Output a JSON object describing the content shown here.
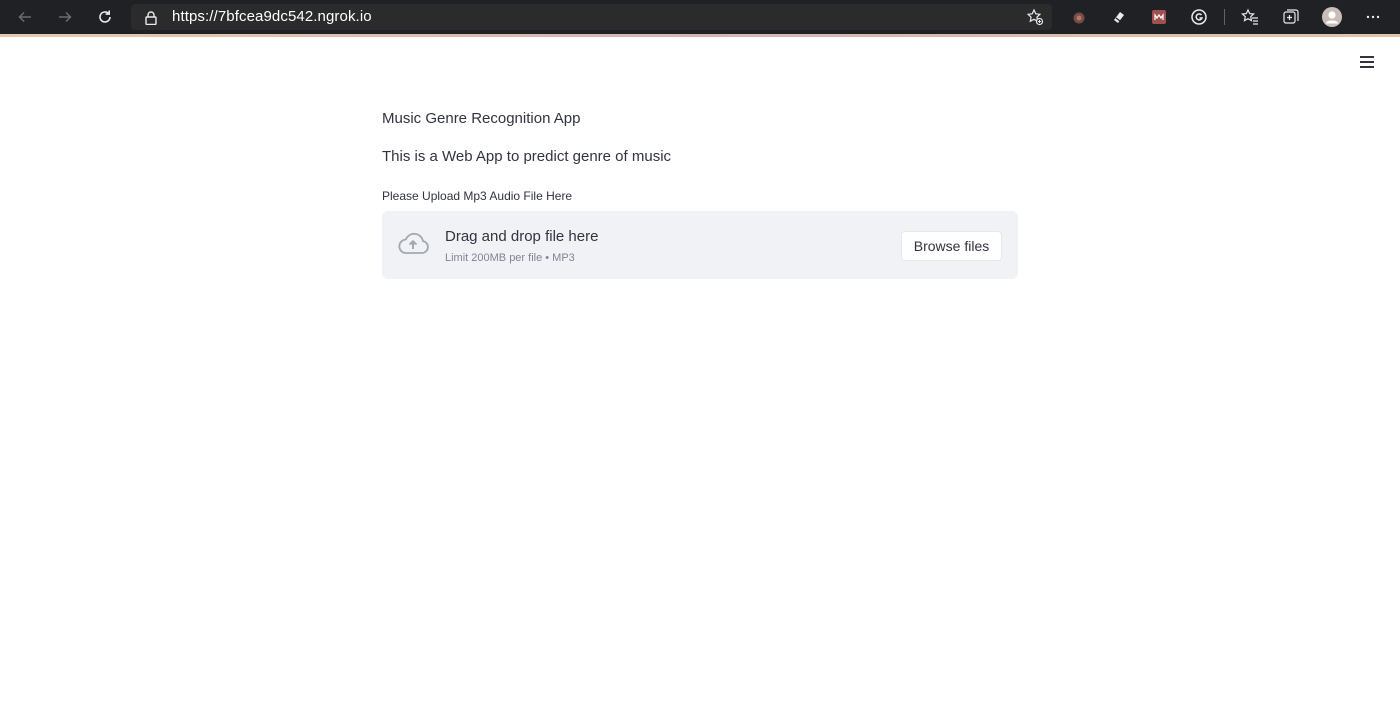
{
  "browser": {
    "url": "https://7bfcea9dc542.ngrok.io",
    "toolbar_icons": [
      "back-icon",
      "forward-icon",
      "refresh-icon",
      "lock-icon",
      "add-favorite-icon",
      "extension-icon",
      "extension-icon",
      "extension-icon",
      "grammarly-icon",
      "favorites-icon",
      "collections-icon",
      "profile-icon",
      "more-icon"
    ]
  },
  "page": {
    "title": "Music Genre Recognition App",
    "subtitle": "This is a Web App to predict genre of music",
    "uploader": {
      "label": "Please Upload Mp3 Audio File Here",
      "dropzone_title": "Drag and drop file here",
      "dropzone_hint": "Limit 200MB per file • MP3",
      "browse_label": "Browse files"
    }
  },
  "colors": {
    "chrome_bg": "#202124",
    "address_bg": "#2b2b2b",
    "text": "#31333f",
    "dropzone_bg": "#f0f2f6",
    "hint": "#808495"
  }
}
